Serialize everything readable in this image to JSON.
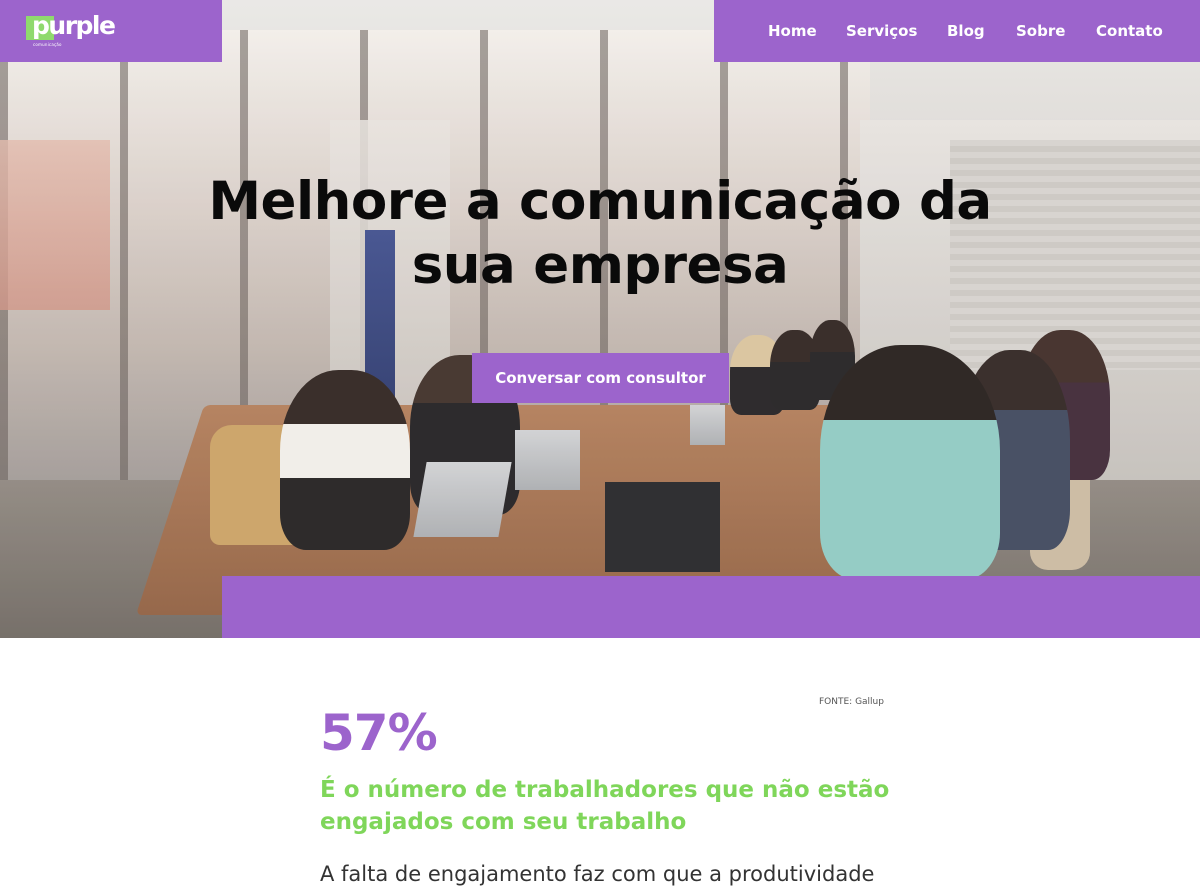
{
  "brand": {
    "name": "purple",
    "tagline": "comunicação",
    "accent": "#9c64cc",
    "highlight": "#8fd96d"
  },
  "nav": {
    "items": [
      {
        "label": "Home"
      },
      {
        "label": "Serviços"
      },
      {
        "label": "Blog"
      },
      {
        "label": "Sobre"
      },
      {
        "label": "Contato"
      }
    ]
  },
  "hero": {
    "headline_line1": "Melhore a comunicação da",
    "headline_line2": "sua empresa",
    "cta_label": "Conversar com consultor"
  },
  "stats": {
    "source": "FONTE: Gallup",
    "number": "57%",
    "caption": "É o número de trabalhadores que não estão engajados com seu trabalho",
    "body": "A falta de engajamento faz com que a produtividade"
  }
}
